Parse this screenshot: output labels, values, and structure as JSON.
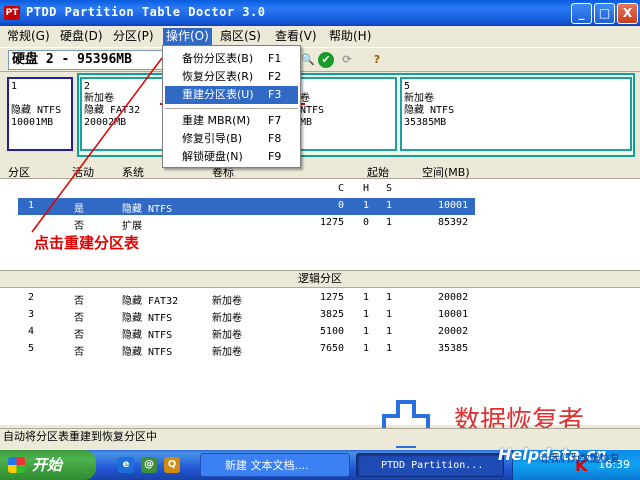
{
  "window": {
    "app_icon": "PT",
    "title": "PTDD Partition Table Doctor 3.0",
    "buttons": {
      "minimize": "_",
      "maximize": "□",
      "close": "X"
    }
  },
  "menubar": [
    {
      "label": "常规(G)"
    },
    {
      "label": "硬盘(D)"
    },
    {
      "label": "分区(P)"
    },
    {
      "label": "操作(O)"
    },
    {
      "label": "扇区(S)"
    },
    {
      "label": "查看(V)"
    },
    {
      "label": "帮助(H)"
    }
  ],
  "toolbar": {
    "disk_select": "硬盘 2 - 95396MB",
    "icons": [
      "search-icon",
      "check-icon",
      "sync-icon",
      "help-icon"
    ],
    "icon_glyphs": {
      "search": "🔍",
      "check": "✔",
      "sync": "⟳",
      "help": "?"
    }
  },
  "partition_map": {
    "partitions": [
      {
        "lines": [
          "1",
          "",
          "隐藏 NTFS",
          "10001MB"
        ]
      },
      {
        "lines": [
          "2",
          "新加卷",
          "隐藏 FAT32",
          "20002MB"
        ]
      },
      {
        "lines": [
          "3",
          "新加卷",
          "隐藏 NTFS",
          "10001MB"
        ]
      },
      {
        "lines": [
          "4",
          "新加卷",
          "隐藏 NTFS",
          "20002MB"
        ]
      },
      {
        "lines": [
          "5",
          "新加卷",
          "隐藏 NTFS",
          "35385MB"
        ]
      }
    ],
    "visible_fragments": {
      "p3_line1": "3",
      "p4_line2": "卷",
      "p4_line3": "NTFS",
      "p4_line4": "MB"
    }
  },
  "dropdown": {
    "items": [
      {
        "label": "备份分区表(B)",
        "key": "F1"
      },
      {
        "label": "恢复分区表(R)",
        "key": "F2"
      },
      {
        "label": "重建分区表(U)",
        "key": "F3"
      },
      {
        "label": "重建 MBR(M)",
        "key": "F7"
      },
      {
        "label": "修复引导(B)",
        "key": "F8"
      },
      {
        "label": "解锁硬盘(N)",
        "key": "F9"
      }
    ],
    "highlighted_index": 2
  },
  "table": {
    "headers": {
      "partition": "分区",
      "active": "活动",
      "system": "系统",
      "label": "卷标",
      "start": "起始",
      "size": "空间(MB)"
    },
    "chs_headers": {
      "c": "C",
      "h": "H",
      "s": "S"
    },
    "primary_rows": [
      {
        "num": "1",
        "active": "是",
        "system": "隐藏 NTFS",
        "label": "",
        "c": "0",
        "h": "1",
        "s": "1",
        "size": "10001",
        "selected": true
      },
      {
        "num": "",
        "active": "否",
        "system": "扩展",
        "label": "",
        "c": "1275",
        "h": "0",
        "s": "1",
        "size": "85392",
        "selected": false
      }
    ],
    "logical_header": "逻辑分区",
    "logical_rows": [
      {
        "num": "2",
        "active": "否",
        "system": "隐藏 FAT32",
        "label": "新加卷",
        "c": "1275",
        "h": "1",
        "s": "1",
        "size": "20002"
      },
      {
        "num": "3",
        "active": "否",
        "system": "隐藏 NTFS",
        "label": "新加卷",
        "c": "3825",
        "h": "1",
        "s": "1",
        "size": "10001"
      },
      {
        "num": "4",
        "active": "否",
        "system": "隐藏 NTFS",
        "label": "新加卷",
        "c": "5100",
        "h": "1",
        "s": "1",
        "size": "20002"
      },
      {
        "num": "5",
        "active": "否",
        "system": "隐藏 NTFS",
        "label": "新加卷",
        "c": "7650",
        "h": "1",
        "s": "1",
        "size": "35385"
      }
    ]
  },
  "statusbar": {
    "text": "自动将分区表重建到恢复分区中"
  },
  "annotation": {
    "text": "点击重建分区表"
  },
  "taskbar": {
    "start": "开始",
    "quicklaunch_glyphs": [
      "e",
      "@",
      "Q"
    ],
    "tasks": [
      {
        "label": "新建 文本文档...."
      },
      {
        "label": "PTDD Partition..."
      }
    ],
    "tray_k": "K",
    "clock": "16:39"
  },
  "watermark": {
    "title": "数据恢复者",
    "url": "Helpdata.cn",
    "sub": "让我们为数据恢复"
  }
}
